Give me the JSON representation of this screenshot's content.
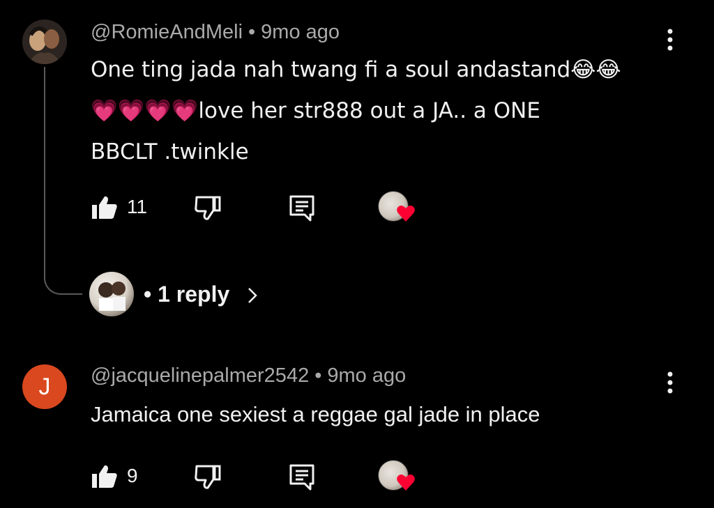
{
  "comments": [
    {
      "author": "@RomieAndMeli",
      "separator": "•",
      "time": "9mo ago",
      "lines": [
        "One ting jada nah twang fi a soul andastand😂😂",
        "💗💗💗💗love her str888 out a JA.. a ONE",
        "BBCLT .twinkle"
      ],
      "likes": "11",
      "replies_label": "• 1 reply"
    },
    {
      "author": "@jacquelinepalmer2542",
      "avatar_letter": "J",
      "separator": "•",
      "time": "9mo ago",
      "lines": [
        "Jamaica one sexiest a reggae gal jade in place"
      ],
      "likes": "9"
    }
  ],
  "colors": {
    "background": "#000000",
    "text": "#f1f1f1",
    "meta": "#aaaaaa",
    "heart": "#ff0033",
    "avatar_j": "#d9481f"
  }
}
